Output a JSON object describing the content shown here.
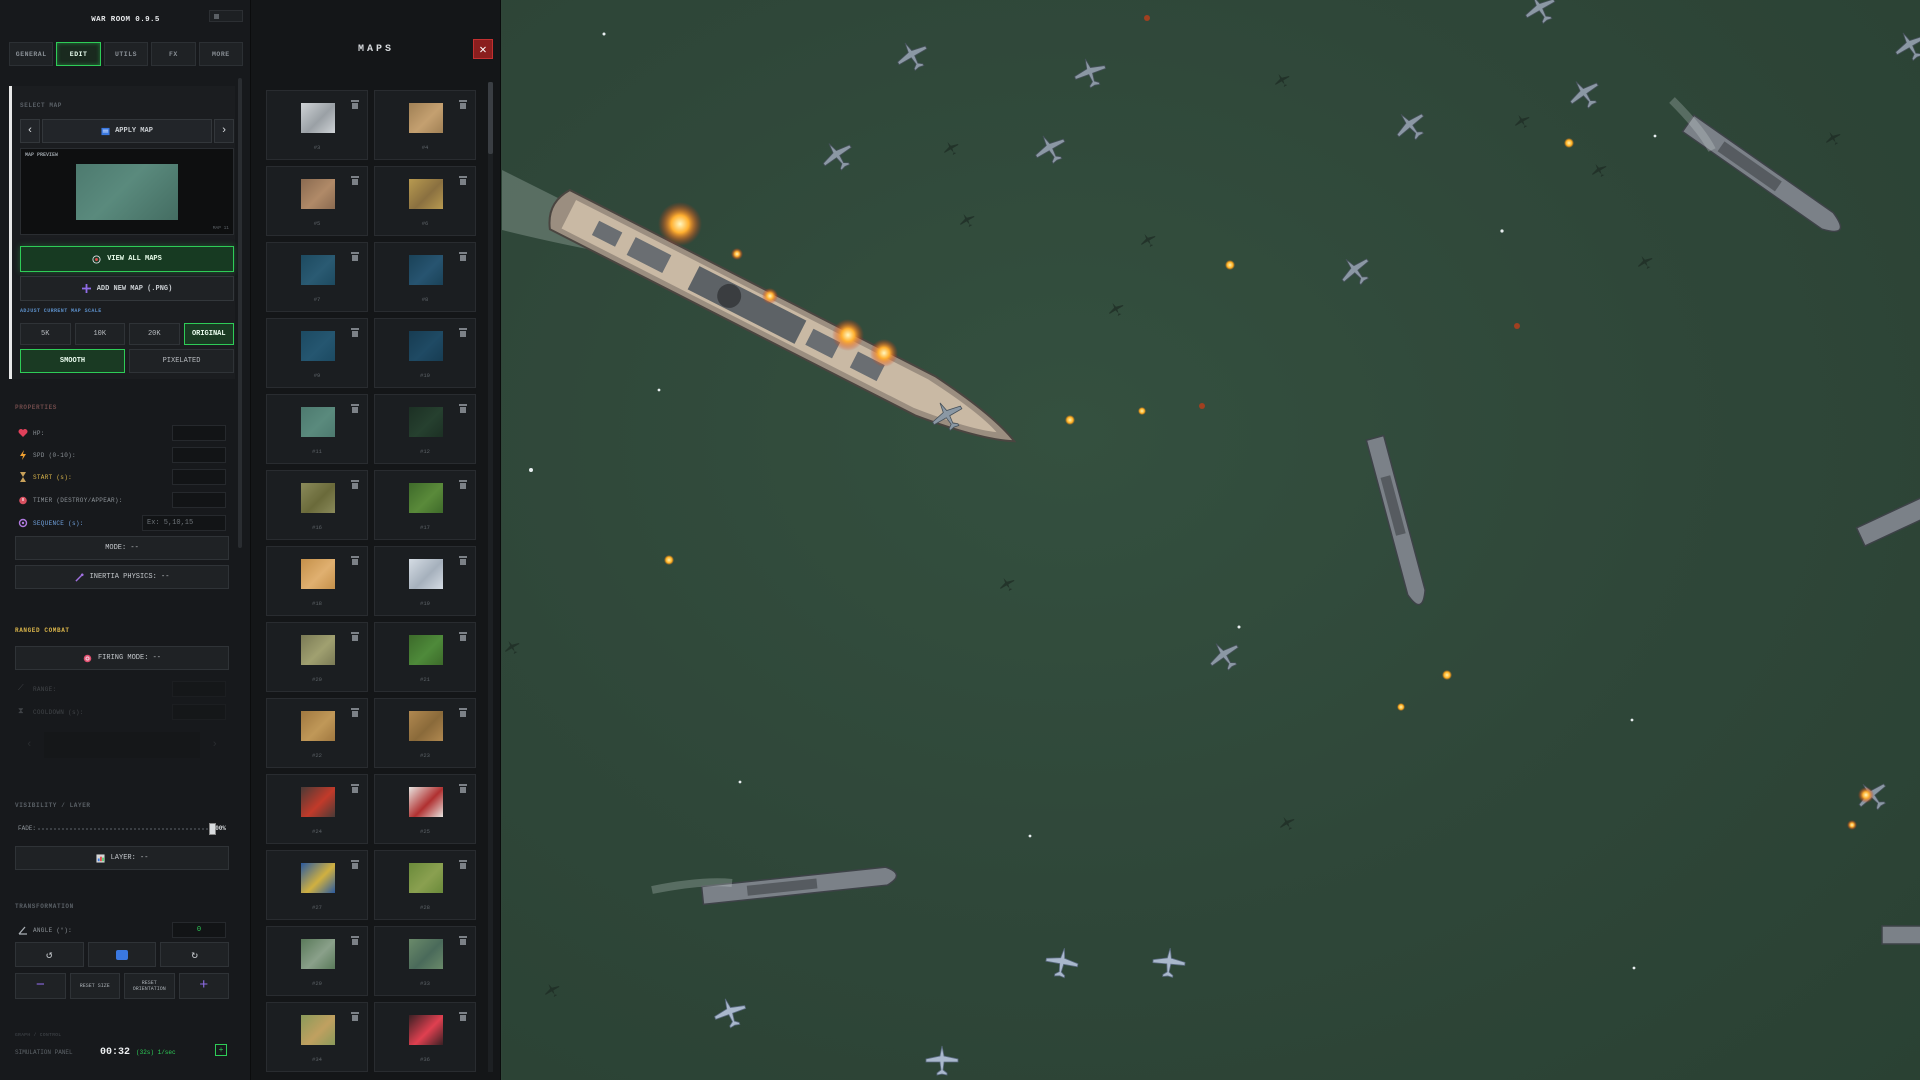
{
  "app": {
    "title": "WAR ROOM 0.9.5"
  },
  "tabs": [
    {
      "label": "GENERAL",
      "active": false
    },
    {
      "label": "EDIT",
      "active": true
    },
    {
      "label": "UTILS",
      "active": false
    },
    {
      "label": "FX",
      "active": false
    },
    {
      "label": "MORE",
      "active": false
    }
  ],
  "map_section": {
    "select_map_label": "SELECT MAP",
    "apply_map_label": "APPLY MAP",
    "prev_icon": "chevron-left-icon",
    "next_icon": "chevron-right-icon",
    "preview_label": "MAP PREVIEW",
    "preview_caption": "MAP 11",
    "view_all_label": "VIEW ALL MAPS",
    "add_new_label": "ADD NEW MAP (.PNG)",
    "scale_label": "ADJUST CURRENT MAP SCALE",
    "scale_options": [
      {
        "label": "5K",
        "active": false
      },
      {
        "label": "10K",
        "active": false
      },
      {
        "label": "20K",
        "active": false
      },
      {
        "label": "ORIGINAL",
        "active": true
      }
    ],
    "render_options": [
      {
        "label": "SMOOTH",
        "active": true
      },
      {
        "label": "PIXELATED",
        "active": false
      }
    ]
  },
  "properties": {
    "label": "PROPERTIES",
    "hp_label": "HP:",
    "spd_label": "SPD (0-10):",
    "start_label": "START (s):",
    "timer_label": "TIMER (DESTROY/APPEAR):",
    "sequence_label": "SEQUENCE (s):",
    "sequence_placeholder": "Ex: 5,10,15",
    "mode_label": "MODE: --",
    "inertia_label": "INERTIA PHYSICS: --"
  },
  "ranged": {
    "label": "RANGED COMBAT",
    "firing_mode_label": "FIRING MODE: --",
    "range_label": "RANGE:",
    "cooldown_label": "COOLDOWN (s):"
  },
  "visibility": {
    "label": "VISIBILITY / LAYER",
    "fade_label": "FADE:",
    "fade_value": "100%",
    "fade_level": 1.0,
    "layer_label": "LAYER: --"
  },
  "transformation": {
    "label": "TRANSFORMATION",
    "angle_label": "ANGLE (°):",
    "angle_value": "0",
    "rotate_left": "↺",
    "rotate_right": "↻",
    "minus": "−",
    "plus": "+",
    "reset_size": "RESET SIZE",
    "reset_orientation": "RESET ORIENTATION"
  },
  "simulation": {
    "section_label": "GRAPH / CONTROL",
    "panel_label": "SIMULATION PANEL",
    "time": "00:32",
    "speed": "(32s) 1/sec",
    "plus": "+"
  },
  "maps_panel": {
    "title": "MAPS",
    "close_icon": "close-icon",
    "maps": [
      {
        "label": "#3",
        "color": "#cfd3d6",
        "accent": "#9aa0a5"
      },
      {
        "label": "#4",
        "color": "#a08055",
        "accent": "#c4a070"
      },
      {
        "label": "#5",
        "color": "#8a6a50",
        "accent": "#b08a68"
      },
      {
        "label": "#6",
        "color": "#b89a50",
        "accent": "#8a7040"
      },
      {
        "label": "#7",
        "color": "#1d4a60",
        "accent": "#2a5a72"
      },
      {
        "label": "#8",
        "color": "#1a4258",
        "accent": "#275470"
      },
      {
        "label": "#9",
        "color": "#1c4a62",
        "accent": "#255670"
      },
      {
        "label": "#10",
        "color": "#173c52",
        "accent": "#1f4a64"
      },
      {
        "label": "#11",
        "color": "#4d7a6f",
        "accent": "#5a8a7d"
      },
      {
        "label": "#12",
        "color": "#1c3024",
        "accent": "#26402f"
      },
      {
        "label": "#16",
        "color": "#8a8a5a",
        "accent": "#6a6a3a"
      },
      {
        "label": "#17",
        "color": "#3e6a2a",
        "accent": "#5a8a3a"
      },
      {
        "label": "#18",
        "color": "#c4904a",
        "accent": "#e0b070"
      },
      {
        "label": "#19",
        "color": "#d5dce4",
        "accent": "#a5b0bc"
      },
      {
        "label": "#20",
        "color": "#7a7a55",
        "accent": "#a0a070"
      },
      {
        "label": "#21",
        "color": "#3c6a2a",
        "accent": "#4e8a3a"
      },
      {
        "label": "#22",
        "color": "#a07840",
        "accent": "#c09858"
      },
      {
        "label": "#23",
        "color": "#b08850",
        "accent": "#8a6a3a"
      },
      {
        "label": "#24",
        "color": "#4a3a36",
        "accent": "#c23a2a"
      },
      {
        "label": "#25",
        "color": "#e8e4e0",
        "accent": "#b03030"
      },
      {
        "label": "#27",
        "color": "#2a5aa0",
        "accent": "#d0b040"
      },
      {
        "label": "#28",
        "color": "#6a8a3a",
        "accent": "#8aa050"
      },
      {
        "label": "#29",
        "color": "#5a7a5a",
        "accent": "#8aa08a"
      },
      {
        "label": "#33",
        "color": "#6a8a6a",
        "accent": "#4a6a5a"
      },
      {
        "label": "#34",
        "color": "#8a9a5a",
        "accent": "#c0a060"
      },
      {
        "label": "#36",
        "color": "#3a2024",
        "accent": "#e04050"
      }
    ]
  },
  "icons": {
    "hp": "heart-icon",
    "spd": "lightning-icon",
    "start": "hourglass-icon",
    "timer": "alarm-icon",
    "sequence": "sequence-icon",
    "inertia": "physics-icon",
    "firing": "target-icon",
    "layer": "layers-icon",
    "angle": "angle-icon",
    "view_all": "eye-icon",
    "add_new": "plus-icon",
    "apply": "map-icon"
  },
  "colors": {
    "accent_green": "#2ecc57",
    "accent_red": "#c23030",
    "sea": "#2f4739"
  }
}
